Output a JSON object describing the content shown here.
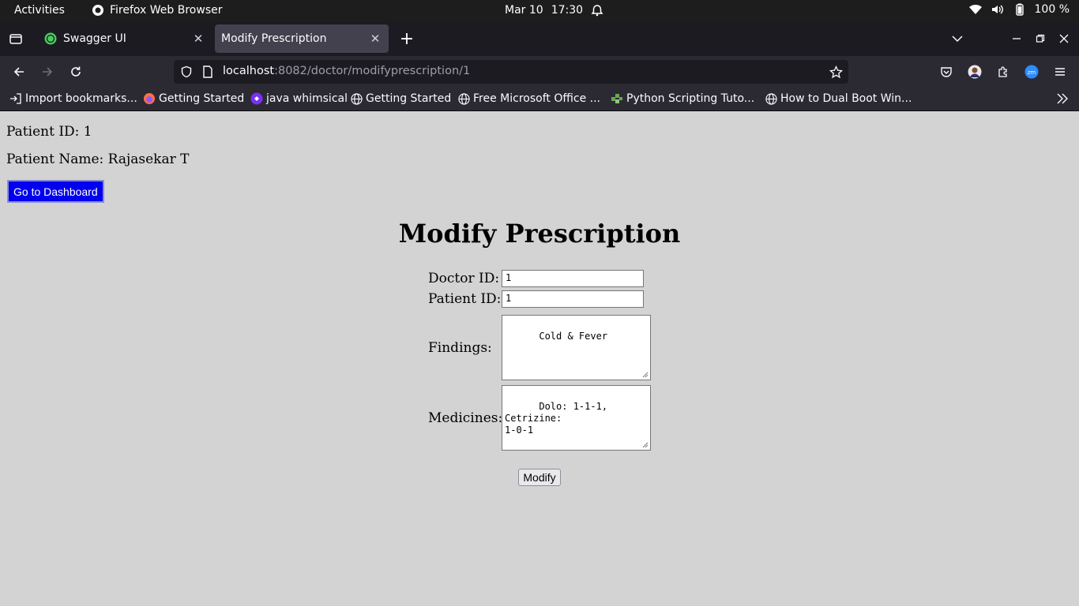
{
  "system_bar": {
    "activities": "Activities",
    "app_name": "Firefox Web Browser",
    "date": "Mar 10",
    "time": "17:30",
    "battery": "100 %"
  },
  "browser": {
    "tabs": [
      {
        "title": "Swagger UI",
        "active": false
      },
      {
        "title": "Modify Prescription",
        "active": true
      }
    ],
    "url_host": "localhost",
    "url_path": ":8082/doctor/modifyprescription/1",
    "bookmarks": [
      {
        "label": "Import bookmarks...",
        "icon": "import-icon"
      },
      {
        "label": "Getting Started",
        "icon": "firefox-icon"
      },
      {
        "label": "java whimsical",
        "icon": "whimsical-icon"
      },
      {
        "label": "Getting Started",
        "icon": "globe-icon"
      },
      {
        "label": "Free Microsoft Office ...",
        "icon": "globe-icon"
      },
      {
        "label": "Python Scripting Tuto...",
        "icon": "python-icon"
      },
      {
        "label": "How to Dual Boot Win...",
        "icon": "globe-icon"
      }
    ]
  },
  "page": {
    "patient_id_line": "Patient ID: 1",
    "patient_name_line": "Patient Name: Rajasekar T",
    "dashboard_button": "Go to Dashboard",
    "title": "Modify Prescription",
    "form": {
      "doctor_id_label": "Doctor ID:",
      "doctor_id_value": "1",
      "patient_id_label": "Patient ID:",
      "patient_id_value": "1",
      "findings_label": "Findings:",
      "findings_value": "Cold & Fever",
      "medicines_label": "Medicines:",
      "medicines_value": "Dolo: 1-1-1, Cetrizine:\n1-0-1",
      "submit_label": "Modify"
    }
  },
  "colors": {
    "page_background": "#d3d3d3",
    "dashboard_button_bg": "#0000ee",
    "browser_chrome": "#2b2a33"
  }
}
